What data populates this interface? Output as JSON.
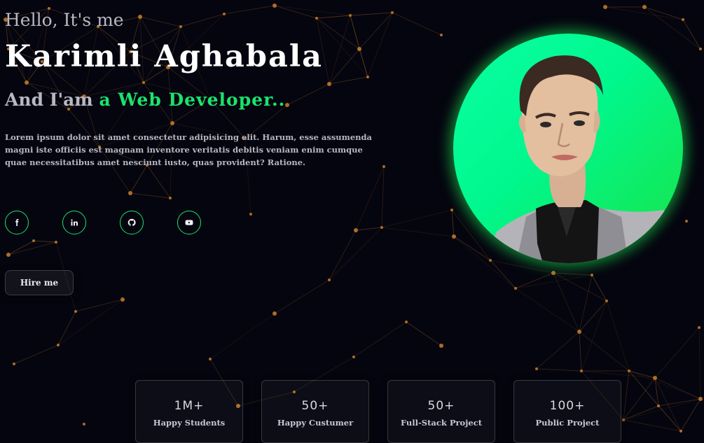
{
  "hero": {
    "greeting": "Hello, It's me",
    "name": "Karimli Aghabala",
    "role_prefix": "And I'am ",
    "role_highlight": "a Web Developer..",
    "intro": "Lorem ipsum dolor sit amet consectetur adipisicing elit. Harum, esse assumenda magni iste officiis est magnam inventore veritatis debitis veniam enim cumque quae necessitatibus amet nesciunt iusto, quas provident? Ratione.",
    "hire_label": "Hire me"
  },
  "socials": [
    {
      "icon": "facebook-icon"
    },
    {
      "icon": "linkedin-icon"
    },
    {
      "icon": "github-icon"
    },
    {
      "icon": "youtube-icon"
    }
  ],
  "stats": [
    {
      "value": "1M+",
      "label": "Happy Students"
    },
    {
      "value": "50+",
      "label": "Happy Custumer"
    },
    {
      "value": "50+",
      "label": "Full-Stack Project"
    },
    {
      "value": "100+",
      "label": "Public Project"
    }
  ],
  "colors": {
    "background": "#05050f",
    "accent": "#19e46c",
    "network": "#c87f2a",
    "portrait_glow": "#19e346"
  }
}
